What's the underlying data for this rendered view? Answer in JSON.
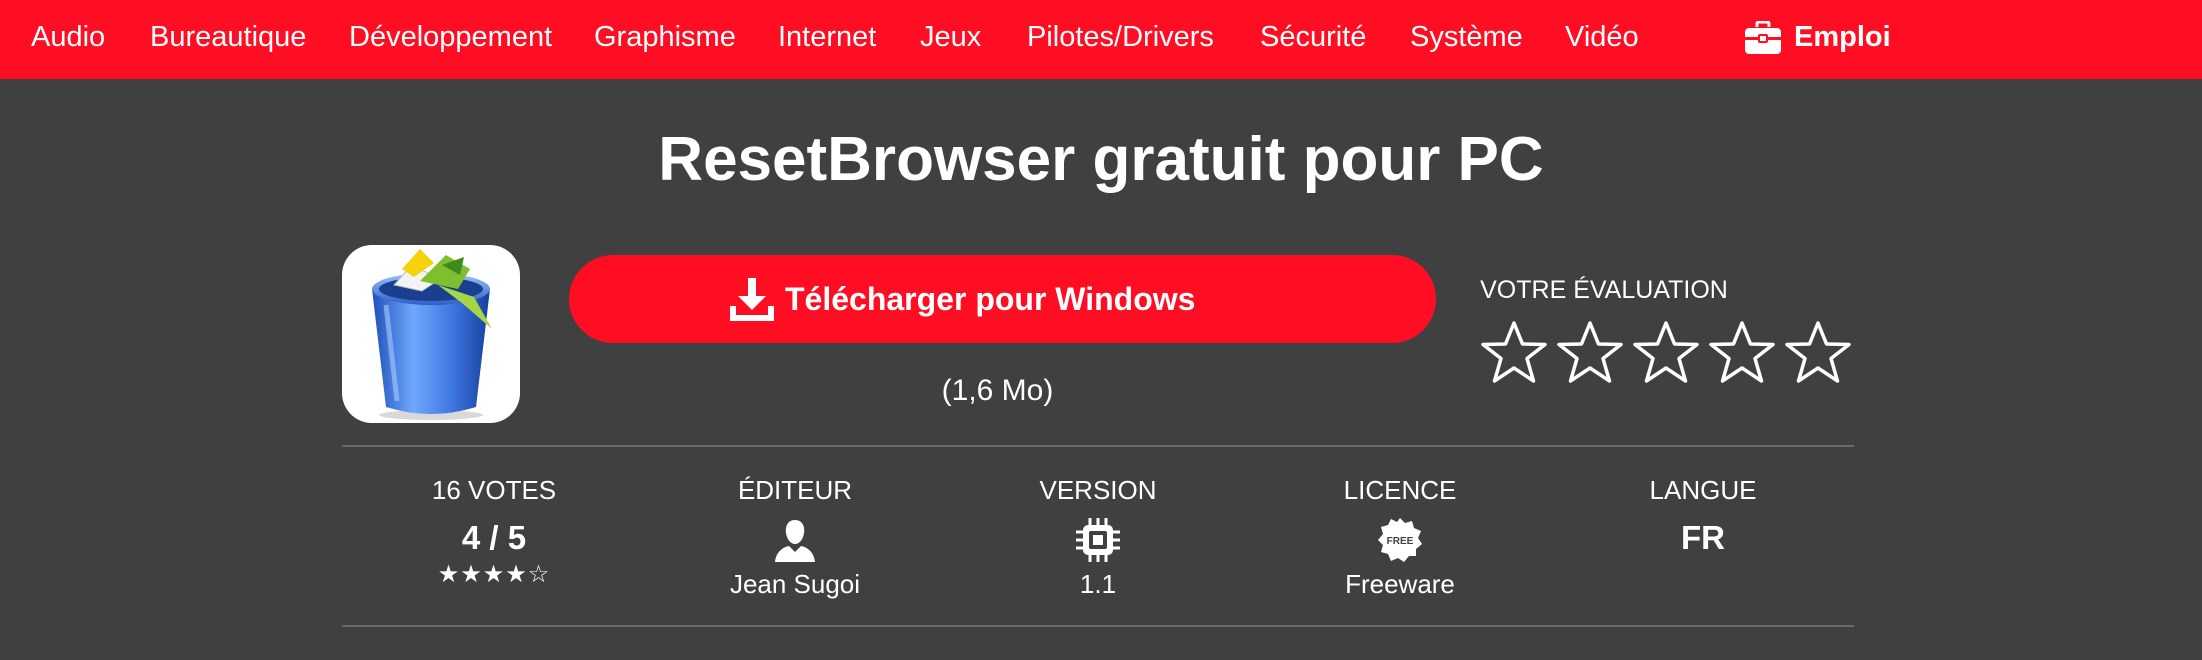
{
  "nav": {
    "items": [
      {
        "label": "Audio"
      },
      {
        "label": "Bureautique"
      },
      {
        "label": "Développement"
      },
      {
        "label": "Graphisme"
      },
      {
        "label": "Internet"
      },
      {
        "label": "Jeux"
      },
      {
        "label": "Pilotes/Drivers"
      },
      {
        "label": "Sécurité"
      },
      {
        "label": "Système"
      },
      {
        "label": "Vidéo"
      }
    ],
    "emploi": {
      "label": "Emploi",
      "icon": "briefcase-icon"
    }
  },
  "page": {
    "title": "ResetBrowser gratuit pour PC",
    "app_icon": "recycle-bin-icon"
  },
  "download": {
    "label": "Télécharger pour Windows",
    "size": "(1,6 Mo)",
    "icon": "download-icon"
  },
  "user_rating": {
    "label": "VOTRE ÉVALUATION",
    "max_stars": 5,
    "selected": 0
  },
  "stats": {
    "votes": {
      "label": "16 VOTES",
      "value": "4 / 5",
      "stars": "★★★★☆",
      "rating": 4,
      "out_of": 5
    },
    "editor": {
      "label": "ÉDITEUR",
      "value": "Jean Sugoi",
      "icon": "user-icon"
    },
    "version": {
      "label": "VERSION",
      "value": "1.1",
      "icon": "chip-icon"
    },
    "license": {
      "label": "LICENCE",
      "value": "Freeware",
      "icon": "free-badge-icon",
      "badge_text": "FREE"
    },
    "language": {
      "label": "LANGUE",
      "value": "FR"
    }
  },
  "colors": {
    "accent": "#ff0d22",
    "background": "#404040",
    "divider": "#6a6a6a",
    "text": "#ffffff"
  }
}
